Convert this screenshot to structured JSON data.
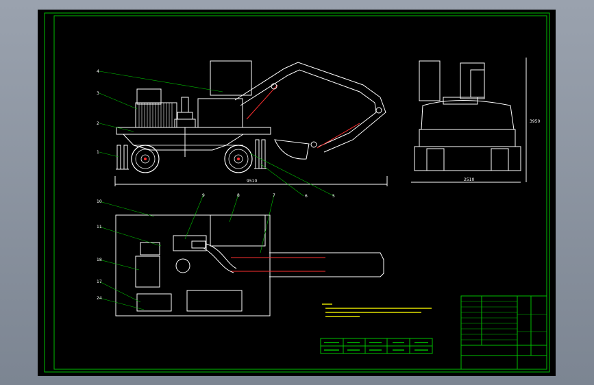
{
  "balloons": {
    "front": [
      "4",
      "3",
      "2",
      "1",
      "6",
      "5"
    ],
    "plan": [
      "10",
      "9",
      "8",
      "7",
      "11",
      "18",
      "17",
      "24"
    ]
  },
  "dims": {
    "side_length": "9510",
    "front_width": "2510",
    "front_height": "3950"
  },
  "colors": {
    "frame": "#00c000",
    "outline": "#ffffff",
    "cylinder": "#ff3030",
    "tech_text": "#e0e000",
    "background": "#000000"
  }
}
